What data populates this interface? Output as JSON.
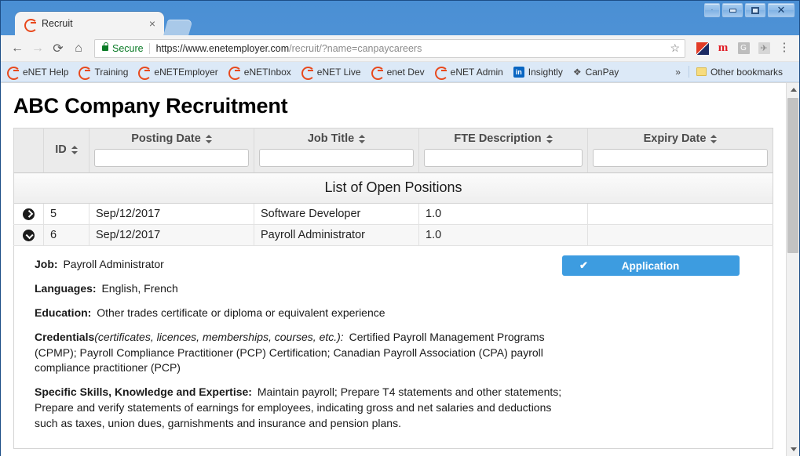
{
  "browser": {
    "tab": {
      "title": "Recruit",
      "favicon": "enet-icon",
      "close": "×"
    },
    "nav": {
      "back": "←",
      "forward": "→",
      "reload": "⟳",
      "home": "⌂"
    },
    "omnibox": {
      "security_label": "Secure",
      "url_domain": "https://www.enetemployer.com",
      "url_path": "/recruit/?name=canpaycareers",
      "bookmark_star": "☆"
    },
    "extensions": [
      {
        "name": "flag-extension-icon",
        "glyph": ""
      },
      {
        "name": "m-extension-icon",
        "glyph": "m"
      },
      {
        "name": "g-extension-icon",
        "glyph": "G"
      },
      {
        "name": "pdf-extension-icon",
        "glyph": "✈"
      },
      {
        "name": "chrome-menu-icon",
        "glyph": "⋮"
      }
    ],
    "bookmarks": [
      {
        "label": "eNET Help",
        "icon": "enet-icon"
      },
      {
        "label": "Training",
        "icon": "enet-icon"
      },
      {
        "label": "eNETEmployer",
        "icon": "enet-icon"
      },
      {
        "label": "eNETInbox",
        "icon": "enet-icon"
      },
      {
        "label": "eNET Live",
        "icon": "enet-icon"
      },
      {
        "label": "enet Dev",
        "icon": "enet-icon"
      },
      {
        "label": "eNET Admin",
        "icon": "enet-icon"
      },
      {
        "label": "Insightly",
        "icon": "linkedin-icon"
      },
      {
        "label": "CanPay",
        "icon": "canpay-icon"
      }
    ],
    "overflow_chevron": "»",
    "other_bookmarks": "Other bookmarks",
    "window_controls": {
      "help": "·",
      "minimize": "–",
      "maximize": "□",
      "close": "✕"
    }
  },
  "page": {
    "title": "ABC Company Recruitment",
    "table_caption": "List of Open Positions",
    "columns": [
      {
        "label": "",
        "sortable": false
      },
      {
        "label": "ID",
        "sortable": true
      },
      {
        "label": "Posting Date",
        "sortable": true
      },
      {
        "label": "Job Title",
        "sortable": true
      },
      {
        "label": "FTE Description",
        "sortable": true
      },
      {
        "label": "Expiry Date",
        "sortable": true
      }
    ],
    "filters": {
      "posting_date": "",
      "job_title": "",
      "fte_description": "",
      "expiry_date": ""
    },
    "rows": [
      {
        "expander": "right",
        "id": "5",
        "posting_date": "Sep/12/2017",
        "job_title": "Software Developer",
        "fte": "1.0",
        "expiry_date": ""
      },
      {
        "expander": "down",
        "id": "6",
        "posting_date": "Sep/12/2017",
        "job_title": "Payroll Administrator",
        "fte": "1.0",
        "expiry_date": ""
      }
    ],
    "detail": {
      "application_button": {
        "label": "Application",
        "icon": "check-icon",
        "color": "#3d9ce0"
      },
      "fields": [
        {
          "label": "Job:",
          "value": "Payroll Administrator"
        },
        {
          "label": "Languages:",
          "value": "English, French"
        },
        {
          "label": "Education:",
          "value": "Other trades certificate or diploma or equivalent experience"
        },
        {
          "label": "Credentials",
          "note": "(certificates, licences, memberships, courses, etc.):",
          "value": "Certified Payroll Management Programs (CPMP); Payroll Compliance Practitioner (PCP) Certification; Canadian Payroll Association (CPA) payroll compliance practitioner (PCP)"
        },
        {
          "label": "Specific Skills, Knowledge and Expertise:",
          "value": "Maintain payroll; Prepare T4 statements and other statements; Prepare and verify statements of earnings for employees, indicating gross and net salaries and deductions such as taxes, union dues, garnishments and insurance and pension plans."
        }
      ]
    }
  }
}
